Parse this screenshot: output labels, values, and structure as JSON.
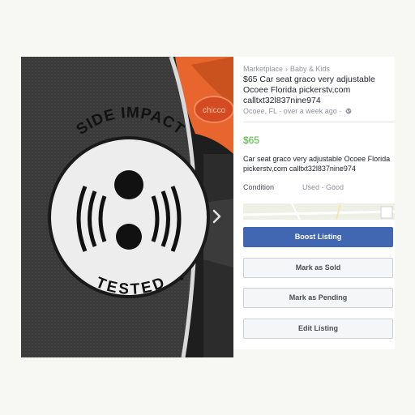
{
  "photo": {
    "badge_top_text": "SIDE IMPACT",
    "badge_bottom_text": "TESTED",
    "badge_mark": "*",
    "logo_text": "chicco",
    "next_icon": "chevron-right-icon"
  },
  "listing": {
    "breadcrumb": [
      "Marketplace",
      "Baby & Kids"
    ],
    "breadcrumb_separator": "›",
    "title": "$65 Car seat graco very adjustable Ocoee Florida pickerstv,com calltxt32l837nine974",
    "location": "Ocoee, FL",
    "time": "over a week ago",
    "meta_separator": "·",
    "price": "$65",
    "description": "Car seat graco very adjustable Ocoee Florida pickerstv,com calltxt32l837nine974",
    "condition_label": "Condition",
    "condition_value": "Used - Good"
  },
  "buttons": {
    "boost": "Boost Listing",
    "sold": "Mark as Sold",
    "pending": "Mark as Pending",
    "edit": "Edit Listing"
  },
  "colors": {
    "price": "#42b72a",
    "primary_button": "#4267b2",
    "seat_orange": "#e8652e"
  }
}
